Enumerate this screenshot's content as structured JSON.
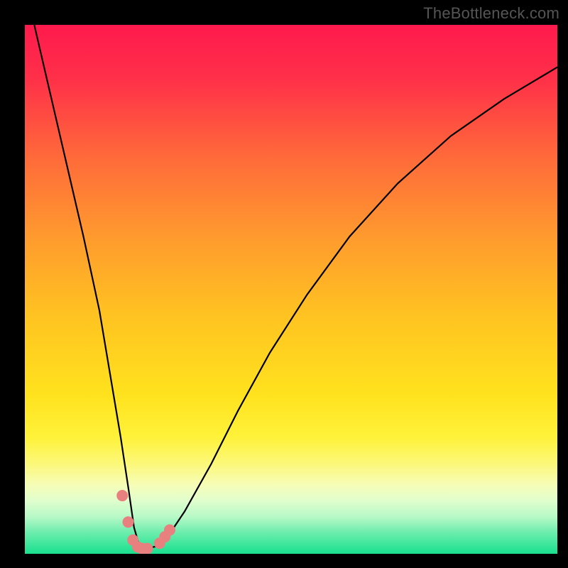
{
  "watermark": "TheBottleneck.com",
  "gradient_stops": [
    {
      "offset": 0.0,
      "color": "#ff1a4d"
    },
    {
      "offset": 0.1,
      "color": "#ff2f49"
    },
    {
      "offset": 0.25,
      "color": "#ff6a3a"
    },
    {
      "offset": 0.4,
      "color": "#ff9a2e"
    },
    {
      "offset": 0.55,
      "color": "#ffc321"
    },
    {
      "offset": 0.7,
      "color": "#ffe21e"
    },
    {
      "offset": 0.78,
      "color": "#fff23a"
    },
    {
      "offset": 0.83,
      "color": "#fcf87a"
    },
    {
      "offset": 0.87,
      "color": "#f6fdb8"
    },
    {
      "offset": 0.9,
      "color": "#e0fecd"
    },
    {
      "offset": 0.93,
      "color": "#b7f9c7"
    },
    {
      "offset": 0.96,
      "color": "#6bedac"
    },
    {
      "offset": 1.0,
      "color": "#19e08f"
    }
  ],
  "chart_data": {
    "type": "line",
    "title": "",
    "xlabel": "",
    "ylabel": "",
    "xlim": [
      0,
      100
    ],
    "ylim": [
      0,
      100
    ],
    "series": [
      {
        "name": "curve",
        "x": [
          0,
          2,
          5,
          8,
          11,
          14,
          16,
          18,
          19.5,
          20.5,
          21.5,
          23,
          25,
          27,
          30,
          35,
          40,
          46,
          53,
          61,
          70,
          80,
          90,
          100
        ],
        "values": [
          108,
          99,
          86,
          73,
          60,
          46,
          34,
          22,
          12,
          5,
          1.5,
          1,
          1.5,
          3.5,
          8,
          17,
          27,
          38,
          49,
          60,
          70,
          79,
          86,
          92
        ]
      }
    ],
    "markers": {
      "name": "dots",
      "color": "#e98080",
      "radius_px": 8,
      "x": [
        18.3,
        19.4,
        20.3,
        21.2,
        22.0,
        23.0,
        25.3,
        26.3,
        27.2
      ],
      "values": [
        11.0,
        6.0,
        2.6,
        1.3,
        1.0,
        1.0,
        2.0,
        3.2,
        4.5
      ]
    },
    "annotations": []
  }
}
